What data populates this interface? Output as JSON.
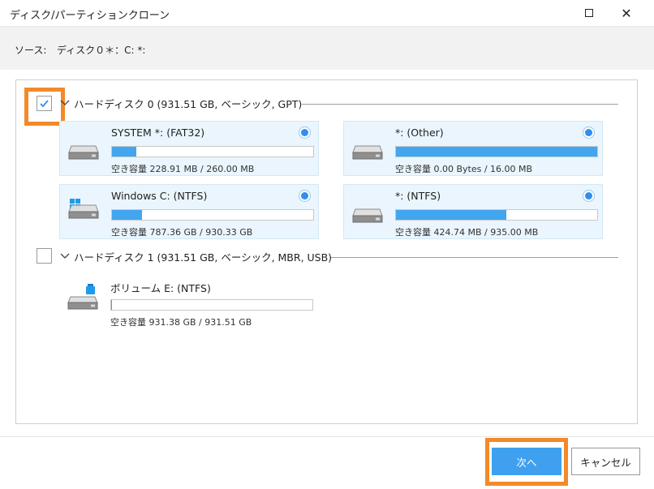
{
  "window": {
    "title": "ディスク/パーティションクローン",
    "maximize_icon": "maximize-icon",
    "close_glyph": "✕"
  },
  "source": {
    "label": "ソース:",
    "value": "ディスク０＊：C: *:"
  },
  "disks": [
    {
      "title": "ハードディスク 0 (931.51 GB, ベーシック, GPT)",
      "checked": true,
      "partitions": [
        {
          "name": "SYSTEM *: (FAT32)",
          "usage_text": "空き容量 228.91 MB / 260.00 MB",
          "used_fraction": 0.12,
          "selected": true,
          "icon": "drive-icon"
        },
        {
          "name": "*: (Other)",
          "usage_text": "空き容量 0.00 Bytes / 16.00 MB",
          "used_fraction": 1.0,
          "selected": true,
          "icon": "drive-icon"
        },
        {
          "name": "Windows C: (NTFS)",
          "usage_text": "空き容量 787.36 GB / 930.33 GB",
          "used_fraction": 0.15,
          "selected": true,
          "icon": "windows-drive-icon"
        },
        {
          "name": "*: (NTFS)",
          "usage_text": "空き容量 424.74 MB / 935.00 MB",
          "used_fraction": 0.55,
          "selected": true,
          "icon": "drive-icon"
        }
      ]
    },
    {
      "title": "ハードディスク 1 (931.51 GB, ベーシック, MBR, USB)",
      "checked": false,
      "partitions": [
        {
          "name": "ボリューム E: (NTFS)",
          "usage_text": "空き容量 931.38 GB / 931.51 GB",
          "used_fraction": 0.005,
          "selected": false,
          "icon": "usb-drive-icon"
        }
      ]
    }
  ],
  "buttons": {
    "next_label": "次へ",
    "cancel_label": "キャンセル"
  },
  "colors": {
    "accent": "#3ea0ef",
    "card_bg": "#eaf5fd",
    "highlight": "#f28a2a"
  }
}
